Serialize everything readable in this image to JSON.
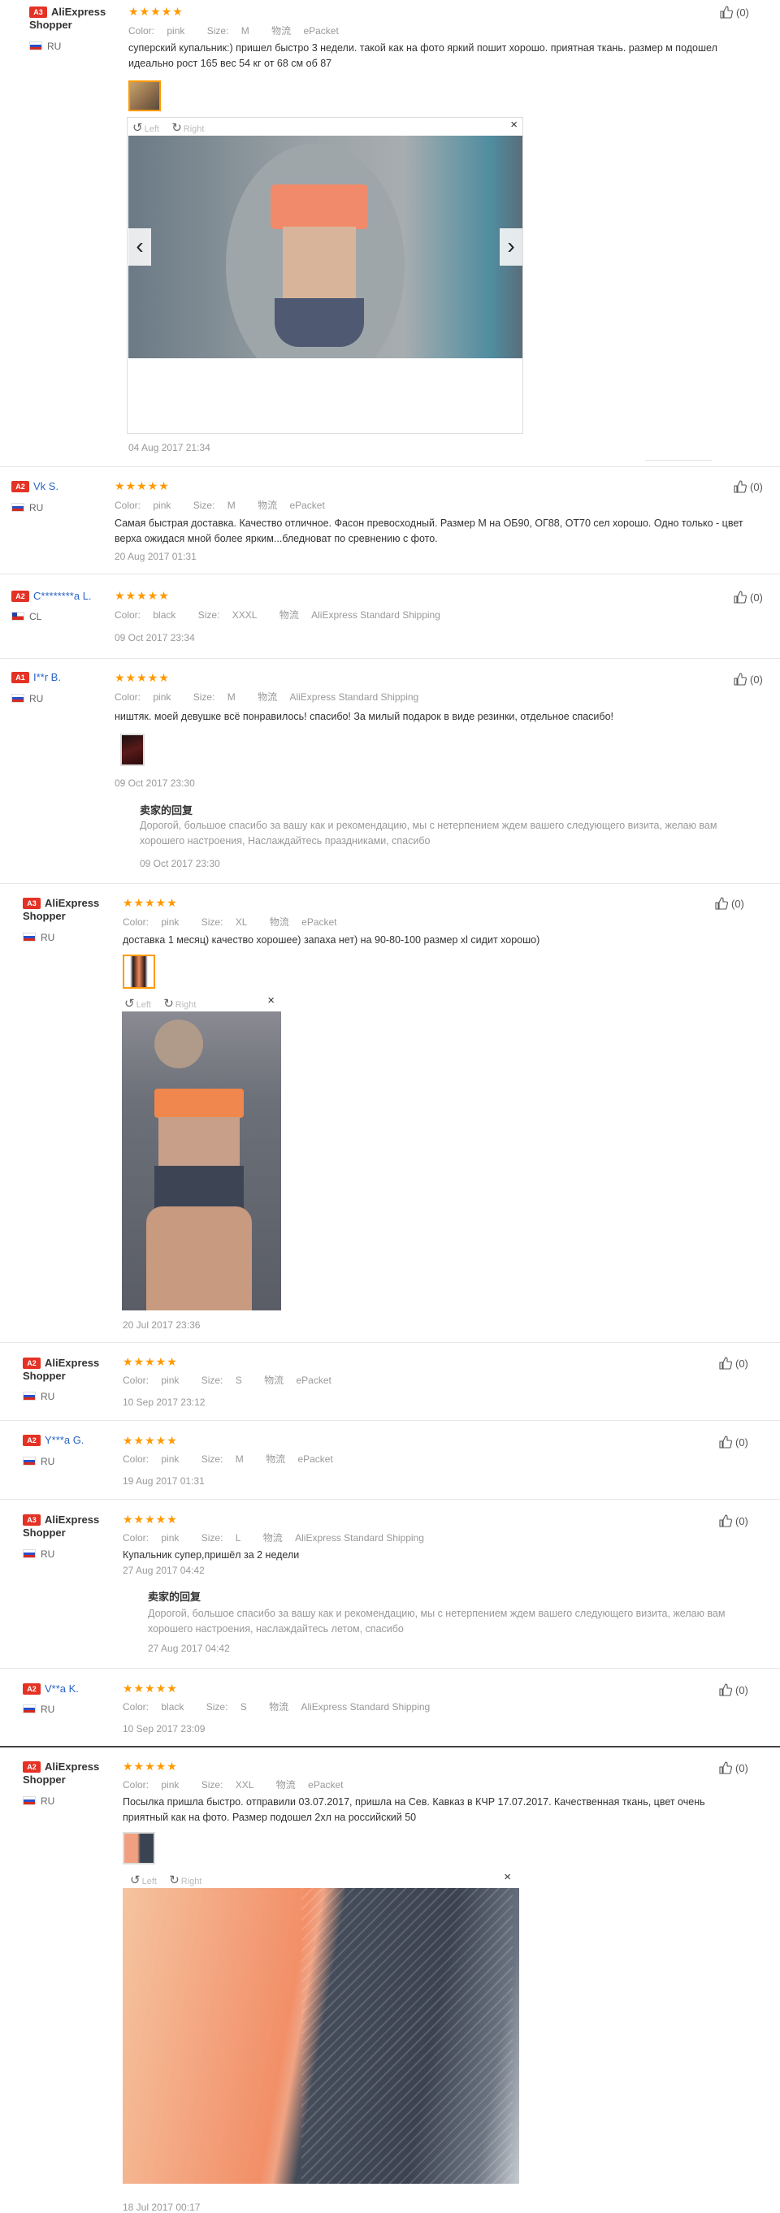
{
  "reviews": [
    {
      "badge": "A3",
      "name": "AliExpress Shopper",
      "country": "RU",
      "stars": "★★★★★",
      "color_label": "Color:",
      "color": "pink",
      "size_label": "Size:",
      "size": "M",
      "ship_label": "物流",
      "ship": "ePacket",
      "text": "суперский купальник:) пришел быстро 3 недели. такой как на фото яркий пошит хорошо. приятная ткань. размер м подошел идеально рост 165 вес 54 кг от 68 см об 87",
      "viewer": {
        "left": "Left",
        "right": "Right",
        "close": "×",
        "prev": "‹",
        "next": "›"
      },
      "date": "04 Aug 2017 21:34",
      "likes": "(0)"
    },
    {
      "badge": "A2",
      "name": "Vk S.",
      "country": "RU",
      "stars": "★★★★★",
      "color_label": "Color:",
      "color": "pink",
      "size_label": "Size:",
      "size": "M",
      "ship_label": "物流",
      "ship": "ePacket",
      "text": "Самая быстрая доставка. Качество отличное. Фасон превосходный. Размер М на ОБ90, ОГ88, ОТ70 сел хорошо. Одно только - цвет верха ожидася мной более ярким...бледноват по сревнению с фото.",
      "date": "20 Aug 2017 01:31",
      "likes": "(0)"
    },
    {
      "badge": "A2",
      "name": "C********a L.",
      "country": "CL",
      "stars": "★★★★★",
      "color_label": "Color:",
      "color": "black",
      "size_label": "Size:",
      "size": "XXXL",
      "ship_label": "物流",
      "ship": "AliExpress Standard Shipping",
      "date": "09 Oct 2017 23:34",
      "likes": "(0)"
    },
    {
      "badge": "A1",
      "name": "I**r B.",
      "country": "RU",
      "stars": "★★★★★",
      "color_label": "Color:",
      "color": "pink",
      "size_label": "Size:",
      "size": "M",
      "ship_label": "物流",
      "ship": "AliExpress Standard Shipping",
      "text": "ништяк. моей девушке всё понравилось! спасибо! За милый подарок в виде резинки, отдельное спасибо!",
      "date": "09 Oct 2017 23:30",
      "reply_title": "卖家的回复",
      "reply_text": "Дорогой, большое спасибо за вашу как и рекомендацию, мы с нетерпением ждем вашего следующего визита, желаю вам хорошего настроения, Наслаждайтесь праздниками, спасибо",
      "reply_date": "09 Oct 2017 23:30",
      "likes": "(0)"
    },
    {
      "badge": "A3",
      "name": "AliExpress Shopper",
      "country": "RU",
      "stars": "★★★★★",
      "color_label": "Color:",
      "color": "pink",
      "size_label": "Size:",
      "size": "XL",
      "ship_label": "物流",
      "ship": "ePacket",
      "text": "доставка 1 месяц) качество хорошее) запаха нет) на 90-80-100 размер xl сидит хорошо)",
      "viewer": {
        "left": "Left",
        "right": "Right",
        "close": "×"
      },
      "date": "20 Jul 2017 23:36",
      "likes": "(0)"
    },
    {
      "badge": "A2",
      "name": "AliExpress Shopper",
      "country": "RU",
      "stars": "★★★★★",
      "color_label": "Color:",
      "color": "pink",
      "size_label": "Size:",
      "size": "S",
      "ship_label": "物流",
      "ship": "ePacket",
      "date": "10 Sep 2017 23:12",
      "likes": "(0)"
    },
    {
      "badge": "A2",
      "name": "Y***a G.",
      "country": "RU",
      "stars": "★★★★★",
      "color_label": "Color:",
      "color": "pink",
      "size_label": "Size:",
      "size": "M",
      "ship_label": "物流",
      "ship": "ePacket",
      "date": "19 Aug 2017 01:31",
      "likes": "(0)"
    },
    {
      "badge": "A3",
      "name": "AliExpress Shopper",
      "country": "RU",
      "stars": "★★★★★",
      "color_label": "Color:",
      "color": "pink",
      "size_label": "Size:",
      "size": "L",
      "ship_label": "物流",
      "ship": "AliExpress Standard Shipping",
      "text": "Купальник супер,пришёл за 2 недели",
      "date": "27 Aug 2017 04:42",
      "reply_title": "卖家的回复",
      "reply_text": "Дорогой, большое спасибо за вашу как и рекомендацию, мы с нетерпением ждем вашего следующего визита, желаю вам хорошего настроения, наслаждайтесь летом, спасибо",
      "reply_date": "27 Aug 2017 04:42",
      "likes": "(0)"
    },
    {
      "badge": "A2",
      "name": "V**a K.",
      "country": "RU",
      "stars": "★★★★★",
      "color_label": "Color:",
      "color": "black",
      "size_label": "Size:",
      "size": "S",
      "ship_label": "物流",
      "ship": "AliExpress Standard Shipping",
      "date": "10 Sep 2017 23:09",
      "likes": "(0)"
    },
    {
      "badge": "A2",
      "name": "AliExpress Shopper",
      "country": "RU",
      "stars": "★★★★★",
      "color_label": "Color:",
      "color": "pink",
      "size_label": "Size:",
      "size": "XXL",
      "ship_label": "物流",
      "ship": "ePacket",
      "text": "Посылка пришла быстро. отправили 03.07.2017, пришла на Сев. Кавказ в КЧР 17.07.2017. Качественная ткань, цвет очень приятный как на фото. Размер подошел 2хл на российский 50",
      "viewer": {
        "left": "Left",
        "right": "Right",
        "close": "×"
      },
      "date": "18 Jul 2017 00:17",
      "likes": "(0)"
    }
  ]
}
